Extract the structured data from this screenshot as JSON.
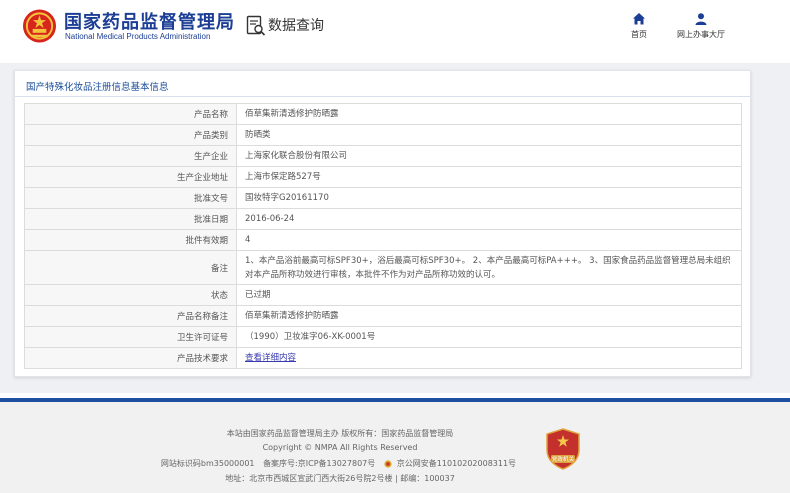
{
  "header": {
    "title_cn": "国家药品监督管理局",
    "title_en": "National Medical Products Administration",
    "module_title": "数据查询",
    "nav": [
      {
        "label": "首页",
        "icon": "home-icon"
      },
      {
        "label": "网上办事大厅",
        "icon": "user-icon"
      }
    ]
  },
  "panel": {
    "title": "国产特殊化妆品注册信息基本信息",
    "rows": [
      {
        "key": "产品名称",
        "value": "佰草集新清透修护防晒露"
      },
      {
        "key": "产品类别",
        "value": "防晒类"
      },
      {
        "key": "生产企业",
        "value": "上海家化联合股份有限公司"
      },
      {
        "key": "生产企业地址",
        "value": "上海市保定路527号"
      },
      {
        "key": "批准文号",
        "value": "国妆特字G20161170"
      },
      {
        "key": "批准日期",
        "value": "2016-06-24"
      },
      {
        "key": "批件有效期",
        "value": "4"
      },
      {
        "key": "备注",
        "value": "1、本产品浴前最高可标SPF30+，浴后最高可标SPF30+。 2、本产品最高可标PA+++。 3、国家食品药品监督管理总局未组织对本产品所称功效进行审核，本批件不作为对产品所称功效的认可。"
      },
      {
        "key": "状态",
        "value": "已过期"
      },
      {
        "key": "产品名称备注",
        "value": "佰草集新清透修护防晒露"
      },
      {
        "key": "卫生许可证号",
        "value": "（1990）卫妆准字06-XK-0001号"
      },
      {
        "key": "产品技术要求",
        "value": "查看详细内容"
      }
    ]
  },
  "footer": {
    "line1": "本站由国家药品监督管理局主办 版权所有：国家药品监督管理局",
    "line2": "Copyright © NMPA All Rights Reserved",
    "site_id": "网站标识码bm35000001",
    "icp": "备案序号:京ICP备13027807号",
    "police": "京公网安备11010202008311号",
    "address": "地址：北京市西城区宣武门西大街26号院2号楼 | 邮编：100037",
    "badge_text": "党政机关"
  },
  "colors": {
    "brand_blue": "#1c3f95",
    "footer_bar": "#1f4fa0",
    "badge_red": "#c4302b"
  }
}
